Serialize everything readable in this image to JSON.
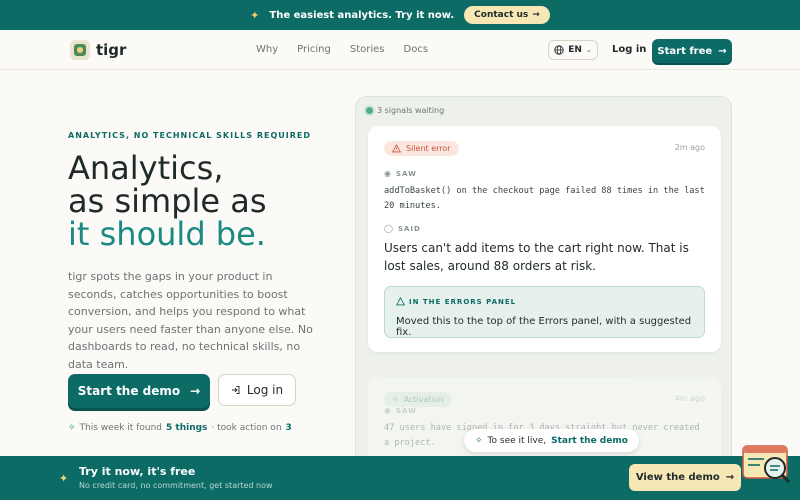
{
  "announcement": {
    "text": "The easiest analytics. Try it now.",
    "button": "Contact us"
  },
  "nav": {
    "brand": "tigr",
    "links": [
      "Why",
      "Pricing",
      "Stories",
      "Docs"
    ],
    "language": "EN",
    "login": "Log in",
    "start": "Start free"
  },
  "hero": {
    "eyebrow": "ANALYTICS, NO TECHNICAL SKILLS REQUIRED",
    "line1": "Analytics,",
    "line2": "as simple as",
    "line3": "it should be.",
    "lead": "tigr spots the gaps in your product in seconds, catches opportunities to boost conversion, and helps you respond to what your users need faster than anyone else. No dashboards to read, no technical skills, no data team.",
    "demo_button": "Start the demo",
    "login_button": "Log in",
    "week_prefix": "This week it found",
    "week_found": "5 things",
    "week_mid": "· took action on",
    "week_action": "3"
  },
  "feed": {
    "waiting": "3 signals waiting",
    "card1": {
      "tag": "Silent error",
      "time": "2m ago",
      "saw_label": "SAW",
      "saw_text": "addToBasket() on the checkout page failed 88 times in the last 20 minutes.",
      "said_label": "SAID",
      "said_text": "Users can't add items to the cart right now. That is lost sales, around 88 orders at risk.",
      "note_label": "IN THE ERRORS PANEL",
      "note_text": "Moved this to the top of the Errors panel, with a suggested fix."
    },
    "card2": {
      "tag": "Activation",
      "time": "4m ago",
      "saw_label": "SAW",
      "saw_text": "47 users have signed in for 3 days straight but never created a project."
    },
    "live_prefix": "To see it live,",
    "live_link": "Start the demo"
  },
  "bottom": {
    "title": "Try it now, it's free",
    "subtitle": "No credit card, no commitment, get started now",
    "button": "View the demo"
  },
  "colors": {
    "brand": "#0d6b66",
    "accent": "#1a8a83",
    "cream": "#f7e7b5",
    "error": "#c8553d"
  }
}
